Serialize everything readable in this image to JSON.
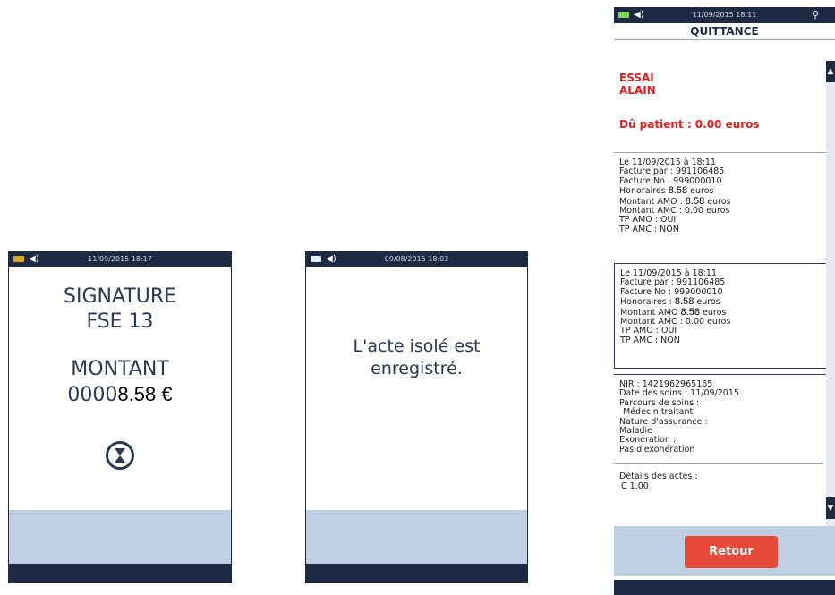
{
  "screen1": {
    "datetime": "11/09/2015 18:17",
    "title_line1": "SIGNATURE",
    "title_line2": "FSE 13",
    "montant_label": "MONTANT",
    "montant_prefix": "0000",
    "montant_value": "8.58 €",
    "icon": "hourglass-icon"
  },
  "screen2": {
    "datetime": "09/08/2015 18:03",
    "message_line1": "L'acte isolé est",
    "message_line2": "enregistré."
  },
  "screen3": {
    "datetime": "11/09/2015 18:11",
    "title": "QUITTANCE",
    "patient_lastname": "ESSAI",
    "patient_firstname": "ALAIN",
    "due": "Dû patient :  0.00 euros",
    "invoice1": {
      "date": "Le 11/09/2015 à 18:11",
      "facture_par": "Facture par : 991106485",
      "facture_no": "Facture No : 999000010",
      "honoraires_label": "Honoraires",
      "honoraires_value": "8.58",
      "honoraires_unit": "euros",
      "amo_label": "Montant AMO :",
      "amo_value": "8.58",
      "amo_unit": "euros",
      "amc": "Montant AMC :   0.00 euros",
      "tp_amo": "TP AMO : OUI",
      "tp_amc": "TP AMC : NON"
    },
    "invoice2": {
      "date": "Le 11/09/2015 à 18:11",
      "facture_par": "Facture par : 991106485",
      "facture_no": "Facture No : 999000010",
      "honoraires_label": "Honoraires :",
      "honoraires_value": "8.58",
      "honoraires_unit": "euros",
      "amo_label": "Montant AMO",
      "amo_value": "8.58",
      "amo_unit": "euros",
      "amc": "Montant AMC :   0.00 euros",
      "tp_amo": "TP AMO : OUI",
      "tp_amc": "TP AMC : NON"
    },
    "details": {
      "nir": "NIR : 1421962965165",
      "date_soins": "Date des soins : 11/09/2015",
      "parcours_label": "Parcours de soins :",
      "parcours_value": "Médecin traitant",
      "nature_label": "Nature d'assurance :",
      "nature_value": "Maladie",
      "exoneration_label": "Exonération :",
      "exoneration_value": "Pas d'exonération",
      "actes_label": "Détails des actes :",
      "actes_value": "C 1.00"
    },
    "retour_label": "Retour",
    "colors": {
      "accent_red": "#e01e1e",
      "button_red": "#e84a3a",
      "navy": "#1c2a44",
      "band": "#bfd0e5"
    }
  }
}
